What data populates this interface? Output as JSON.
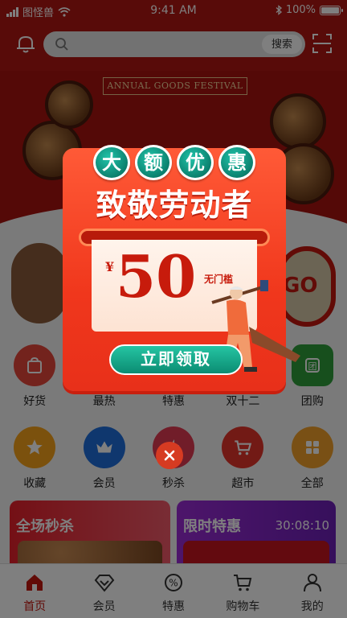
{
  "status_bar": {
    "carrier": "图怪兽",
    "time": "9:41 AM",
    "battery": "100%"
  },
  "search": {
    "placeholder": "",
    "button": "搜索"
  },
  "banner": {
    "title": "ANNUAL GOODS FESTIVAL"
  },
  "grid_row1": [
    {
      "label": "好货",
      "color": "#e7473a",
      "icon": "bag-icon"
    },
    {
      "label": "最热",
      "color": "#f07b2d",
      "icon": "fire-icon"
    },
    {
      "label": "特惠",
      "color": "#e0322a",
      "icon": "discount-icon"
    },
    {
      "label": "双十二",
      "color": "#8b3a9b",
      "icon": "calendar-icon"
    },
    {
      "label": "团购",
      "color": "#2f9e3b",
      "icon": "group-icon"
    }
  ],
  "grid_row2": [
    {
      "label": "收藏",
      "color": "#f7a21b",
      "icon": "star-icon"
    },
    {
      "label": "会员",
      "color": "#1f6fdc",
      "icon": "crown-icon"
    },
    {
      "label": "秒杀",
      "color": "#e23a53",
      "icon": "flash-icon"
    },
    {
      "label": "超市",
      "color": "#e5352b",
      "icon": "cart-icon"
    },
    {
      "label": "全部",
      "color": "#f2a12a",
      "icon": "apps-icon"
    }
  ],
  "promos": {
    "left_title": "全场秒杀",
    "right_title": "限时特惠",
    "countdown": "30:08:10"
  },
  "tabs": [
    {
      "label": "首页",
      "icon": "home-icon",
      "active": true
    },
    {
      "label": "会员",
      "icon": "diamond-icon",
      "active": false
    },
    {
      "label": "特惠",
      "icon": "discount-icon",
      "active": false
    },
    {
      "label": "购物车",
      "icon": "cart-icon",
      "active": false
    },
    {
      "label": "我的",
      "icon": "user-icon",
      "active": false
    }
  ],
  "popup": {
    "badges": [
      "大",
      "额",
      "优",
      "惠"
    ],
    "headline": "致敬劳动者",
    "currency": "¥",
    "amount": "50",
    "threshold": "无门槛",
    "cta": "立即领取"
  },
  "colors": {
    "brand_red": "#c4170f",
    "teal": "#0b8c72"
  }
}
